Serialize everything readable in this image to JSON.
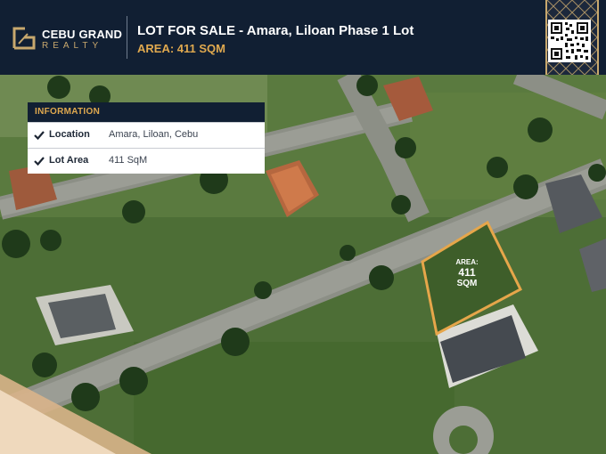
{
  "brand": {
    "name_top": "CEBU GRAND",
    "name_bottom": "REALTY"
  },
  "header": {
    "title": "LOT FOR SALE -  Amara, Liloan Phase 1 Lot",
    "subtitle": "AREA: 411 SQM"
  },
  "info_panel": {
    "heading": "INFORMATION",
    "rows": [
      {
        "label": "Location",
        "value": "Amara, Liloan, Cebu"
      },
      {
        "label": "Lot Area",
        "value": "411 SqM"
      }
    ]
  },
  "lot_marker": {
    "line1": "AREA:",
    "line2": "411",
    "line3": "SQM"
  },
  "colors": {
    "navy": "#111f33",
    "gold": "#e0a94f",
    "lot_outline": "#e6a64a"
  }
}
